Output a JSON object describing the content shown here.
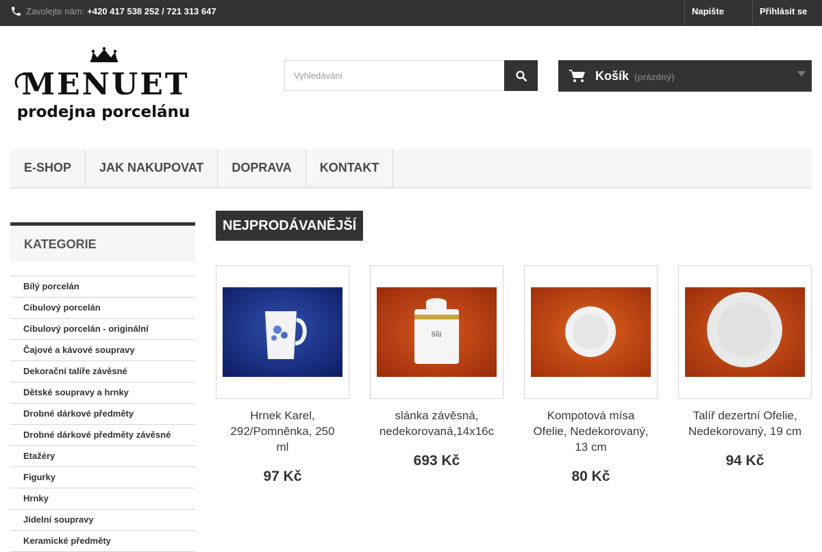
{
  "topbar": {
    "call_label": "Zavolejte nám:",
    "phone": "+420 417 538 252 / 721 313 647",
    "contact_link": "Napište nám",
    "login_link": "Přihlásit se"
  },
  "search": {
    "placeholder": "Vyhledávání"
  },
  "cart": {
    "title": "Košík",
    "status": "(prázdný)"
  },
  "nav": {
    "items": [
      "E-SHOP",
      "JAK NAKUPOVAT",
      "DOPRAVA",
      "KONTAKT"
    ]
  },
  "sidebar": {
    "heading": "KATEGORIE",
    "items": [
      "Bílý porcelán",
      "Cibulový porcelán",
      "Cibulový porcelán - originální",
      "Čajové a kávové soupravy",
      "Dekorační talíře závěsné",
      "Dětské soupravy a hrnky",
      "Drobné dárkové předměty",
      "Drobné dárkové předměty závěsné",
      "Etažéry",
      "Figurky",
      "Hrnky",
      "Jídelní soupravy",
      "Keramické předměty"
    ]
  },
  "main": {
    "section_title": "NEJPRODÁVANĚJŠÍ",
    "products": [
      {
        "name": "Hrnek Karel, 292/Pomněnka, 250 ml",
        "price": "97 Kč"
      },
      {
        "name": "slánka závěsná, nedekorovaná,14x16c",
        "price": "693 Kč"
      },
      {
        "name": "Kompotová mísa Ofelie, Nedekorovaný, 13 cm",
        "price": "80 Kč"
      },
      {
        "name": "Talíř dezertní Ofelie, Nedekorovaný, 19 cm",
        "price": "94 Kč"
      }
    ]
  },
  "logo": {
    "brand": "MENUET",
    "tagline": "prodejna porcelánu"
  },
  "colors": {
    "dark": "#333333",
    "nav_bg": "#f6f6f6",
    "border": "#d6d4d4"
  }
}
